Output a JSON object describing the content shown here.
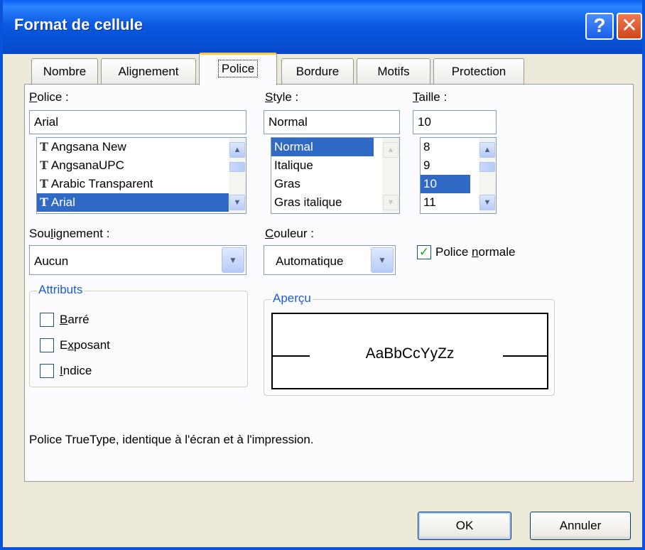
{
  "window": {
    "title": "Format de cellule",
    "help_label": "?",
    "close_label": "✕"
  },
  "tabs": [
    {
      "label": "Nombre"
    },
    {
      "label": "Alignement"
    },
    {
      "label": "Police",
      "active": true
    },
    {
      "label": "Bordure"
    },
    {
      "label": "Motifs"
    },
    {
      "label": "Protection"
    }
  ],
  "font": {
    "label_u": "P",
    "label_rest": "olice :",
    "value": "Arial",
    "items": [
      "Angsana New",
      "AngsanaUPC",
      "Arabic Transparent",
      "Arial"
    ],
    "selected": "Arial"
  },
  "style": {
    "label_u": "S",
    "label_rest": "tyle :",
    "value": "Normal",
    "items": [
      "Normal",
      "Italique",
      "Gras",
      "Gras italique"
    ],
    "selected": "Normal"
  },
  "size": {
    "label_u": "T",
    "label_rest": "aille :",
    "value": "10",
    "items": [
      "8",
      "9",
      "10",
      "11"
    ],
    "selected": "10"
  },
  "underline": {
    "label_a": "Sou",
    "label_u": "l",
    "label_b": "ignement :",
    "value": "Aucun"
  },
  "color": {
    "label_u": "C",
    "label_rest": "ouleur :",
    "value": "Automatique"
  },
  "normal_font": {
    "label_a": "Police ",
    "label_u": "n",
    "label_b": "ormale",
    "checked": true,
    "check_mark": "✓"
  },
  "attributes": {
    "legend": "Attributs",
    "items": [
      {
        "label_u": "B",
        "label_rest": "arré",
        "checked": false
      },
      {
        "label_a": "E",
        "label_u": "x",
        "label_rest": "posant",
        "checked": false
      },
      {
        "label_u": "I",
        "label_rest": "ndice",
        "checked": false
      }
    ]
  },
  "preview": {
    "legend": "Aperçu",
    "sample": "AaBbCcYyZz"
  },
  "info_text": "Police TrueType, identique à l'écran et à l'impression.",
  "buttons": {
    "ok": "OK",
    "cancel": "Annuler"
  },
  "icons": {
    "truetype": "T",
    "up": "▲",
    "down": "▼"
  }
}
